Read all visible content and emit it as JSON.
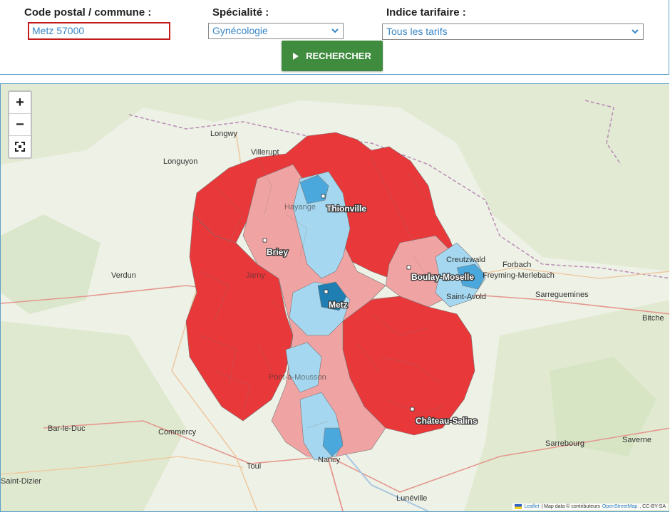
{
  "search": {
    "postal_label": "Code postal / commune :",
    "postal_value": "Metz 57000",
    "specialty_label": "Spécialité :",
    "specialty_value": "Gynécologie",
    "tariff_label": "Indice tarifaire :",
    "tariff_value": "Tous les tarifs",
    "button_label": "RECHERCHER"
  },
  "map": {
    "zoom_in_label": "+",
    "zoom_out_label": "−",
    "zoom_in_icon": "plus-icon",
    "zoom_out_icon": "minus-icon",
    "fullscreen_icon": "fullscreen-icon",
    "cities": [
      "Thionville",
      "Briey",
      "Metz",
      "Boulay-Moselle",
      "Château-Salins"
    ],
    "places": [
      "Longwy",
      "Villerupt",
      "Longuyon",
      "Verdun",
      "Forbach",
      "Freyming-Merlebach",
      "Creutzwald",
      "Saint-Avold",
      "Sarreguemines",
      "Bitche",
      "Bar-le-Duc",
      "Commercy",
      "Toul",
      "Nancy",
      "Sarrebourg",
      "Saverne",
      "Lunéville",
      "Saint-Dizier",
      "Pont-à-Mousson",
      "Hayange",
      "Jarny"
    ],
    "colors": {
      "region_red": "#e8383a",
      "region_pink": "#f0a3a3",
      "region_light_blue": "#a5d8f0",
      "region_blue": "#4aa8dc",
      "region_dark_blue": "#1f7fb3"
    },
    "attribution": {
      "leaflet": "Leaflet",
      "text": "| Map data © contributeurs",
      "osm": "OpenStreetMap",
      "license": ", CC-BY-SA"
    }
  }
}
